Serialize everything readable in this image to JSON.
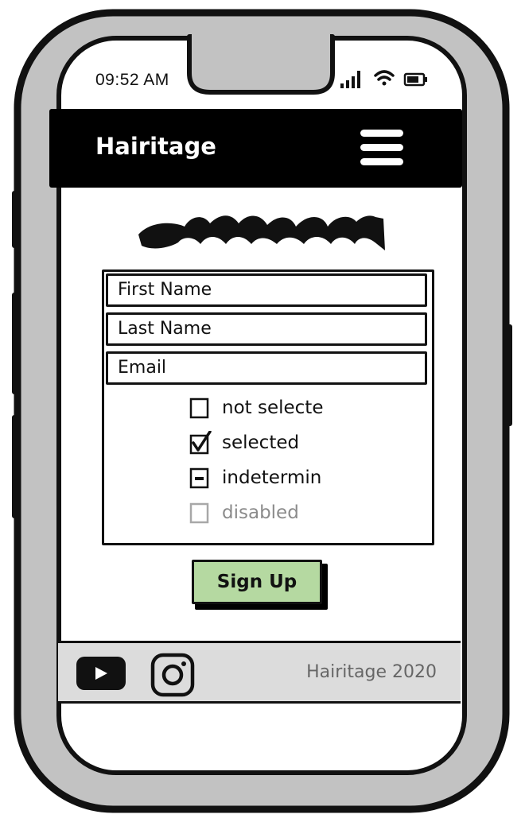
{
  "status_bar": {
    "time": "09:52 AM",
    "icons": [
      "signal-icon",
      "wifi-icon",
      "battery-icon"
    ]
  },
  "header": {
    "title": "Hairitage",
    "menu_icon": "hamburger-menu-icon"
  },
  "form": {
    "fields": [
      {
        "placeholder": "First Name"
      },
      {
        "placeholder": "Last Name"
      },
      {
        "placeholder": "Email"
      }
    ],
    "checkboxes": [
      {
        "label": "not selecte",
        "state": "unchecked"
      },
      {
        "label": "selected",
        "state": "checked"
      },
      {
        "label": "indetermin",
        "state": "indeterminate"
      },
      {
        "label": "disabled",
        "state": "disabled"
      }
    ]
  },
  "signup": {
    "label": "Sign Up",
    "color": "#b5d9a1"
  },
  "footer": {
    "icons": [
      "youtube-icon",
      "instagram-icon"
    ],
    "copyright": "Hairitage 2020"
  },
  "colors": {
    "header_bg": "#000000",
    "phone_frame": "#c2c2c2",
    "footer_bg": "#dcdcdc",
    "button_bg": "#b5d9a1"
  }
}
